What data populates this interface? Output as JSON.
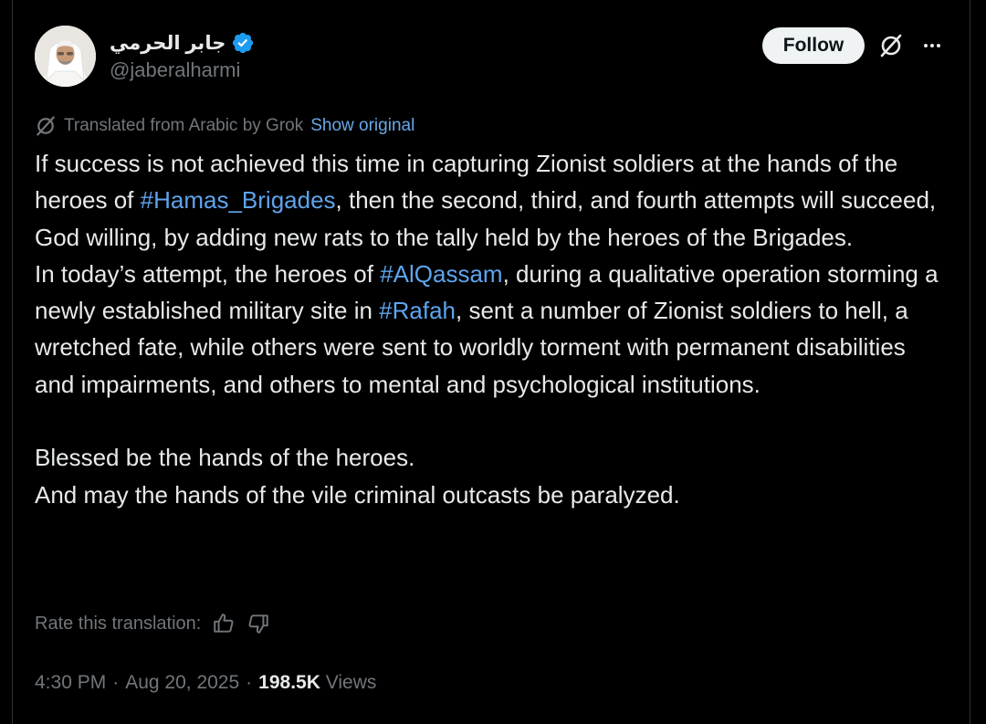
{
  "author": {
    "display_name": "جابر الحرمي",
    "handle": "@jaberalharmi",
    "verified": true
  },
  "actions": {
    "follow_label": "Follow"
  },
  "translation": {
    "notice": "Translated from Arabic by Grok",
    "show_original_label": "Show original",
    "rate_label": "Rate this translation:"
  },
  "post": {
    "p1_a": "If success is not achieved this time in capturing Zionist soldiers at the hands of the heroes of ",
    "p1_tag": "#Hamas_Brigades",
    "p1_b": ", then the second, third, and fourth attempts will succeed, God willing, by adding new rats to the tally held by the heroes of the Brigades.",
    "p2_a": "In today’s attempt, the heroes of ",
    "p2_tag1": "#AlQassam",
    "p2_b": ", during a qualitative operation storming a newly established military site in ",
    "p2_tag2": "#Rafah",
    "p2_c": ", sent a number of Zionist soldiers to hell, a wretched fate, while others were sent to worldly torment with permanent disabilities and impairments, and others to mental and psychological institutions.",
    "p3": "Blessed be the hands of the heroes.",
    "p4": "And may the hands of the vile criminal outcasts be paralyzed."
  },
  "meta": {
    "time": "4:30 PM",
    "date": "Aug 20, 2025",
    "views_count": "198.5K",
    "views_label": "Views",
    "separator": "·"
  },
  "colors": {
    "background": "#000000",
    "text": "#e7e9ea",
    "muted": "#71767b",
    "link": "#5fa4ec",
    "verified": "#1d9bf0"
  },
  "icons": [
    "avatar",
    "verified-badge-icon",
    "grok-icon",
    "more-icon",
    "thumbs-up-icon",
    "thumbs-down-icon"
  ]
}
